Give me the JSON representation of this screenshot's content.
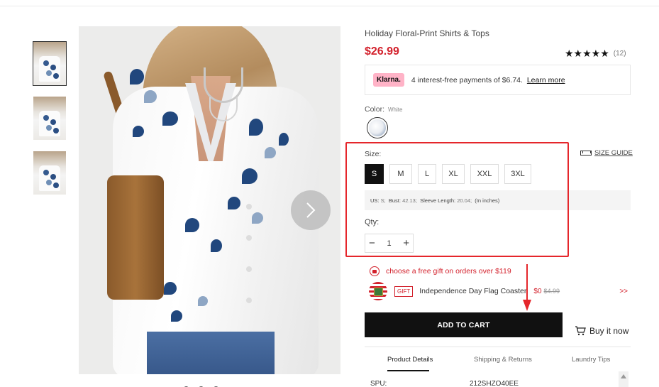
{
  "product": {
    "title": "Holiday Floral-Print Shirts & Tops",
    "price": "$26.99",
    "rating_stars": "★★★★★",
    "rating": 5,
    "review_count": "(12)"
  },
  "klarna": {
    "logo": "Klarna.",
    "text": "4 interest-free payments of $6.74.",
    "link": "Learn more"
  },
  "color": {
    "label": "Color:",
    "value": "White"
  },
  "size": {
    "label": "Size:",
    "guide_label": "SIZE GUIDE",
    "options": [
      "S",
      "M",
      "L",
      "XL",
      "XXL",
      "3XL"
    ],
    "selected": "S",
    "measurements": {
      "us_label": "US:",
      "us_value": "S;",
      "bust_label": "Bust:",
      "bust_value": "42.13;",
      "sleeve_label": "Sleeve Length:",
      "sleeve_value": "20.04;",
      "unit": "(In inches)"
    }
  },
  "quantity": {
    "label": "Qty:",
    "minus": "−",
    "value": "1",
    "plus": "+"
  },
  "gift": {
    "promo": "choose a free gift on orders over $119",
    "tag": "GIFT",
    "name": "Independence Day Flag Coaster",
    "price": "$0",
    "old_price": "$4.99",
    "more": ">>"
  },
  "actions": {
    "add_to_cart": "ADD TO CART",
    "buy_now": "Buy it now"
  },
  "tabs": [
    "Product Details",
    "Shipping & Returns",
    "Laundry Tips"
  ],
  "active_tab": "Product Details",
  "details": {
    "spu_label": "SPU:",
    "spu_value": "212SHZO40EE"
  },
  "icons": {
    "next": "chevron-right-icon",
    "cart": "cart-icon",
    "ruler": "ruler-icon",
    "gift": "gift-icon",
    "flag": "flag-coaster-icon"
  },
  "colors": {
    "price_red": "#d3212c",
    "highlight_red": "#e5262b",
    "klarna_pink": "#ffb3c7",
    "button_black": "#111111"
  }
}
